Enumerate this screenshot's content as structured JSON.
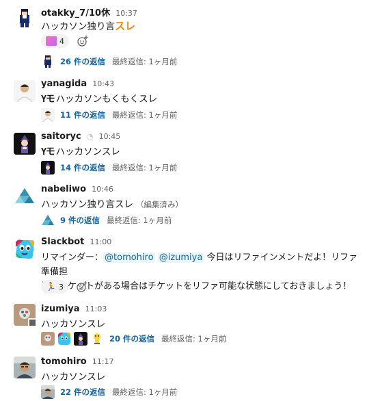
{
  "messages": [
    {
      "name": "otakky_7/10休",
      "time": "10:37",
      "text": "ハッカソン独り言",
      "emoji_suffix": "スレ",
      "reaction_count": "4",
      "thread": {
        "count": "26 件の返信",
        "last": "最終返信: 1ヶ月前"
      }
    },
    {
      "name": "yanagida",
      "time": "10:43",
      "prefix": "Yモ",
      "text": "ハッカソンもくもくスレ",
      "thread": {
        "count": "11 件の返信",
        "last": "最終返信: 1ヶ月前"
      }
    },
    {
      "name": "saitoryc",
      "time": "10:45",
      "prefix": "Yモ",
      "text": "ハッカソンスレ",
      "thread": {
        "count": "14 件の返信",
        "last": "最終返信: 1ヶ月前"
      }
    },
    {
      "name": "nabeliwo",
      "time": "10:46",
      "text": "ハッカソン独り言スレ",
      "edited": "（編集済み）",
      "thread": {
        "count": "9 件の返信",
        "last": "最終返信: 1ヶ月前"
      }
    },
    {
      "name": "Slackbot",
      "time": "11:00",
      "text_pre": "リマインダー：",
      "mention1": "@tomohiro",
      "mention2": "@izumiya",
      "text_post": " 今日はリファインメントだよ！リファ準備担",
      "text_line2": "当のチケットがある場合はチケットをリファ可能な状態にしておきましょう！",
      "reaction_count": "3"
    },
    {
      "name": "izumiya",
      "time": "11:03",
      "text": "ハッカソンスレ",
      "thread": {
        "count": "20 件の返信",
        "last": "最終返信: 1ヶ月前"
      }
    },
    {
      "name": "tomohiro",
      "time": "11:17",
      "text": "ハッカソンスレ",
      "thread": {
        "count": "22 件の返信",
        "last": "最終返信: 1ヶ月前"
      }
    }
  ],
  "colors": {
    "link": "#1264a3",
    "muted": "#616061",
    "text": "#1d1c1d",
    "mention_bg": "#e8f5fa"
  },
  "icons": [
    "add-reaction-icon",
    "away-status-icon",
    "emoji-reaction"
  ]
}
